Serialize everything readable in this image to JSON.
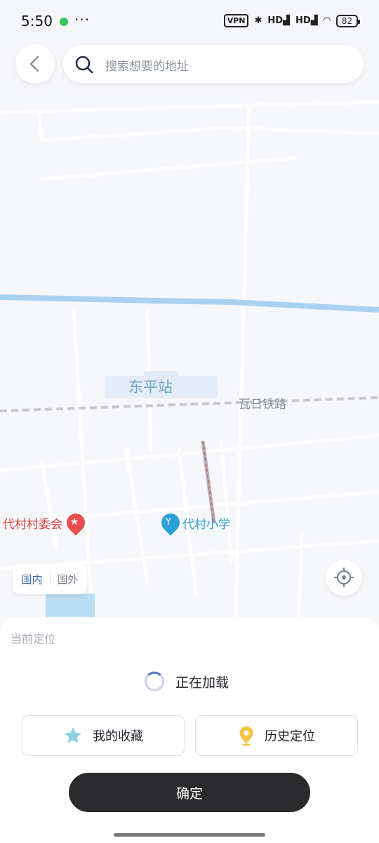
{
  "status_bar": {
    "time": "5:50",
    "more": "···",
    "vpn": "VPN",
    "signal1": "HD",
    "signal2": "HD",
    "battery": "82"
  },
  "search": {
    "placeholder": "搜索想要的地址"
  },
  "map": {
    "station_label": "东平站",
    "rail_label": "瓦日铁路",
    "poi_village_committee": "代村村委会",
    "poi_school": "代村小学",
    "colors": {
      "water": "#a9d1f2",
      "road": "#ffffff",
      "rail": "#c8c8cc",
      "path": "#b0b0b6"
    }
  },
  "region_toggle": {
    "domestic": "国内",
    "abroad": "国外"
  },
  "sheet": {
    "title": "当前定位",
    "loading_text": "正在加载",
    "favorites_label": "我的收藏",
    "history_label": "历史定位",
    "confirm_label": "确定"
  },
  "icons": [
    "back-icon",
    "search-icon",
    "star-icon",
    "location-pin-icon",
    "locate-target-icon"
  ]
}
